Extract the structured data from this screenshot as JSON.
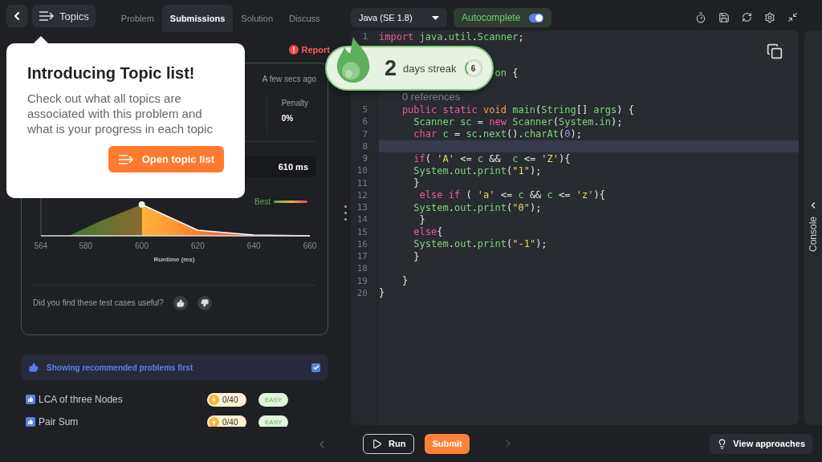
{
  "nav": {
    "topics_label": "Topics",
    "tabs": [
      {
        "label": "Problem",
        "selected": false
      },
      {
        "label": "Submissions",
        "selected": true
      },
      {
        "label": "Solution",
        "selected": false
      },
      {
        "label": "Discuss",
        "selected": false
      }
    ]
  },
  "report_label": "Report",
  "submission": {
    "time": "A few secs ago",
    "stats": [
      {
        "label": "Penalty",
        "value": "0%"
      }
    ],
    "runtime": "610 ms",
    "runtime_chart": {
      "legend": "Best",
      "x_ticks": [
        "564",
        "580",
        "600",
        "620",
        "640",
        "660"
      ],
      "xlabel": "Runtime (ms)"
    },
    "feedback_question": "Did you find these test cases useful?"
  },
  "recommendation": {
    "text": "Showing recommended problems first",
    "checked": true
  },
  "problems": [
    {
      "title": "LCA of three Nodes",
      "score": "0/40",
      "difficulty": "EASY"
    },
    {
      "title": "Pair Sum",
      "score": "0/40",
      "difficulty": "EASY"
    }
  ],
  "popup": {
    "title": "Introducing Topic list!",
    "body": "Check out what all topics are associated with this problem and what is your progress in each topic",
    "button": "Open topic list"
  },
  "streak": {
    "count": "2",
    "label": "days streak",
    "badge": "6"
  },
  "editor": {
    "language": "Java (SE 1.8)",
    "autocomplete": {
      "label": "Autocomplete",
      "on": true
    },
    "lines": [
      {
        "kind": "code",
        "number": "1",
        "current": false,
        "tokens": [
          {
            "kind": "kw",
            "text": "import"
          },
          {
            "kind": "id",
            "text": " java"
          },
          {
            "kind": "p",
            "text": "."
          },
          {
            "kind": "id",
            "text": "util"
          },
          {
            "kind": "p",
            "text": "."
          },
          {
            "kind": "id",
            "text": "Scanner"
          },
          {
            "kind": "p",
            "text": ";"
          }
        ]
      },
      {
        "kind": "code",
        "current": false
      },
      {
        "kind": "code",
        "current": false
      },
      {
        "kind": "code",
        "current": false,
        "tokens": [
          {
            "kind": "id",
            "text": "                    on"
          },
          {
            "kind": "p",
            "text": " {"
          }
        ]
      },
      {
        "kind": "lens",
        "text": "0 references"
      },
      {
        "kind": "code",
        "number": "5",
        "current": false,
        "tokens": [
          {
            "kind": "kw",
            "text": "    public"
          },
          {
            "kind": "kw",
            "text": " static"
          },
          {
            "kind": "ty",
            "text": " void"
          },
          {
            "kind": "id",
            "text": " main"
          },
          {
            "kind": "p",
            "text": "("
          },
          {
            "kind": "id",
            "text": "String"
          },
          {
            "kind": "p",
            "text": "[] "
          },
          {
            "kind": "id",
            "text": "args"
          },
          {
            "kind": "p",
            "text": ") {"
          }
        ]
      },
      {
        "kind": "code",
        "number": "6",
        "current": false,
        "tokens": [
          {
            "kind": "id",
            "text": "      Scanner"
          },
          {
            "kind": "id",
            "text": " sc"
          },
          {
            "kind": "p",
            "text": " = "
          },
          {
            "kind": "kw",
            "text": "new"
          },
          {
            "kind": "id",
            "text": " Scanner"
          },
          {
            "kind": "p",
            "text": "("
          },
          {
            "kind": "id",
            "text": "System"
          },
          {
            "kind": "p",
            "text": "."
          },
          {
            "kind": "id",
            "text": "in"
          },
          {
            "kind": "p",
            "text": ");"
          }
        ]
      },
      {
        "kind": "code",
        "number": "7",
        "current": false,
        "tokens": [
          {
            "kind": "kw",
            "text": "      char"
          },
          {
            "kind": "id",
            "text": " c"
          },
          {
            "kind": "p",
            "text": " = "
          },
          {
            "kind": "id",
            "text": "sc"
          },
          {
            "kind": "p",
            "text": "."
          },
          {
            "kind": "id",
            "text": "next"
          },
          {
            "kind": "p",
            "text": "()."
          },
          {
            "kind": "id",
            "text": "charAt"
          },
          {
            "kind": "p",
            "text": "("
          },
          {
            "kind": "num",
            "text": "0"
          },
          {
            "kind": "p",
            "text": ");"
          }
        ]
      },
      {
        "kind": "code",
        "number": "8",
        "current": true
      },
      {
        "kind": "code",
        "number": "9",
        "current": false,
        "tokens": [
          {
            "kind": "kw",
            "text": "      if"
          },
          {
            "kind": "p",
            "text": "( "
          },
          {
            "kind": "str",
            "text": "'A'"
          },
          {
            "kind": "p",
            "text": " <= "
          },
          {
            "kind": "id",
            "text": "c"
          },
          {
            "kind": "p",
            "text": " &&  "
          },
          {
            "kind": "id",
            "text": "c"
          },
          {
            "kind": "p",
            "text": " <= "
          },
          {
            "kind": "str",
            "text": "'Z'"
          },
          {
            "kind": "p",
            "text": "){"
          }
        ]
      },
      {
        "kind": "code",
        "number": "10",
        "current": false,
        "tokens": [
          {
            "kind": "id",
            "text": "      System"
          },
          {
            "kind": "p",
            "text": "."
          },
          {
            "kind": "id",
            "text": "out"
          },
          {
            "kind": "p",
            "text": "."
          },
          {
            "kind": "id",
            "text": "print"
          },
          {
            "kind": "p",
            "text": "("
          },
          {
            "kind": "str",
            "text": "\"1\""
          },
          {
            "kind": "p",
            "text": ");"
          }
        ]
      },
      {
        "kind": "code",
        "number": "11",
        "current": false,
        "tokens": [
          {
            "kind": "p",
            "text": "      }"
          }
        ]
      },
      {
        "kind": "code",
        "number": "12",
        "current": false,
        "tokens": [
          {
            "kind": "kw",
            "text": "       else"
          },
          {
            "kind": "kw",
            "text": " if"
          },
          {
            "kind": "p",
            "text": " ( "
          },
          {
            "kind": "str",
            "text": "'a'"
          },
          {
            "kind": "p",
            "text": " <= "
          },
          {
            "kind": "id",
            "text": "c"
          },
          {
            "kind": "p",
            "text": " && "
          },
          {
            "kind": "id",
            "text": "c"
          },
          {
            "kind": "p",
            "text": " <= "
          },
          {
            "kind": "str",
            "text": "'z'"
          },
          {
            "kind": "p",
            "text": "){"
          }
        ]
      },
      {
        "kind": "code",
        "number": "13",
        "current": false,
        "tokens": [
          {
            "kind": "id",
            "text": "      System"
          },
          {
            "kind": "p",
            "text": "."
          },
          {
            "kind": "id",
            "text": "out"
          },
          {
            "kind": "p",
            "text": "."
          },
          {
            "kind": "id",
            "text": "print"
          },
          {
            "kind": "p",
            "text": "("
          },
          {
            "kind": "str",
            "text": "\"0\""
          },
          {
            "kind": "p",
            "text": ");"
          }
        ]
      },
      {
        "kind": "code",
        "number": "14",
        "current": false,
        "tokens": [
          {
            "kind": "p",
            "text": "       }"
          }
        ]
      },
      {
        "kind": "code",
        "number": "15",
        "current": false,
        "tokens": [
          {
            "kind": "kw",
            "text": "      else"
          },
          {
            "kind": "p",
            "text": "{"
          }
        ]
      },
      {
        "kind": "code",
        "number": "16",
        "current": false,
        "tokens": [
          {
            "kind": "id",
            "text": "      System"
          },
          {
            "kind": "p",
            "text": "."
          },
          {
            "kind": "id",
            "text": "out"
          },
          {
            "kind": "p",
            "text": "."
          },
          {
            "kind": "id",
            "text": "print"
          },
          {
            "kind": "p",
            "text": "("
          },
          {
            "kind": "str",
            "text": "\"-1\""
          },
          {
            "kind": "p",
            "text": ");"
          }
        ]
      },
      {
        "kind": "code",
        "number": "17",
        "current": false,
        "tokens": [
          {
            "kind": "p",
            "text": "      }"
          }
        ]
      },
      {
        "kind": "code",
        "number": "18",
        "current": false
      },
      {
        "kind": "code",
        "number": "19",
        "current": false,
        "tokens": [
          {
            "kind": "p",
            "text": "    }"
          }
        ]
      },
      {
        "kind": "code",
        "number": "20",
        "current": false,
        "tokens": [
          {
            "kind": "p",
            "text": "}"
          }
        ]
      }
    ]
  },
  "console_label": "Console",
  "actions": {
    "run": "Run",
    "submit": "Submit",
    "approaches": "View approaches"
  }
}
